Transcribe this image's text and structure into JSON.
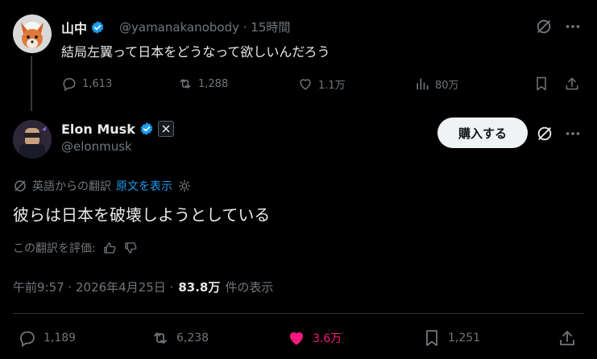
{
  "parent_tweet": {
    "display_name": "山中",
    "handle_time": "@yamanakanobody · 15時間",
    "text": "結局左翼って日本をどうなって欲しいんだろう",
    "actions": {
      "replies": "1,613",
      "reposts": "1,288",
      "likes": "1.1万",
      "views": "80万"
    }
  },
  "main_tweet": {
    "display_name": "Elon Musk",
    "handle": "@elonmusk",
    "buy_button": "購入する",
    "translation_label": "英語からの翻訳",
    "show_original": "原文を表示",
    "text": "彼らは日本を破壊しようとしている",
    "rate_translation": "この翻訳を評価:",
    "timestamp": "午前9:57 · 2026年4月25日 ·",
    "view_count": "83.8万",
    "view_suffix": "件の表示",
    "actions": {
      "replies": "1,189",
      "reposts": "6,238",
      "likes": "3.6万",
      "bookmarks": "1,251"
    }
  },
  "colors": {
    "accent": "#1d9bf0",
    "like": "#f91880",
    "muted": "#71767b"
  }
}
